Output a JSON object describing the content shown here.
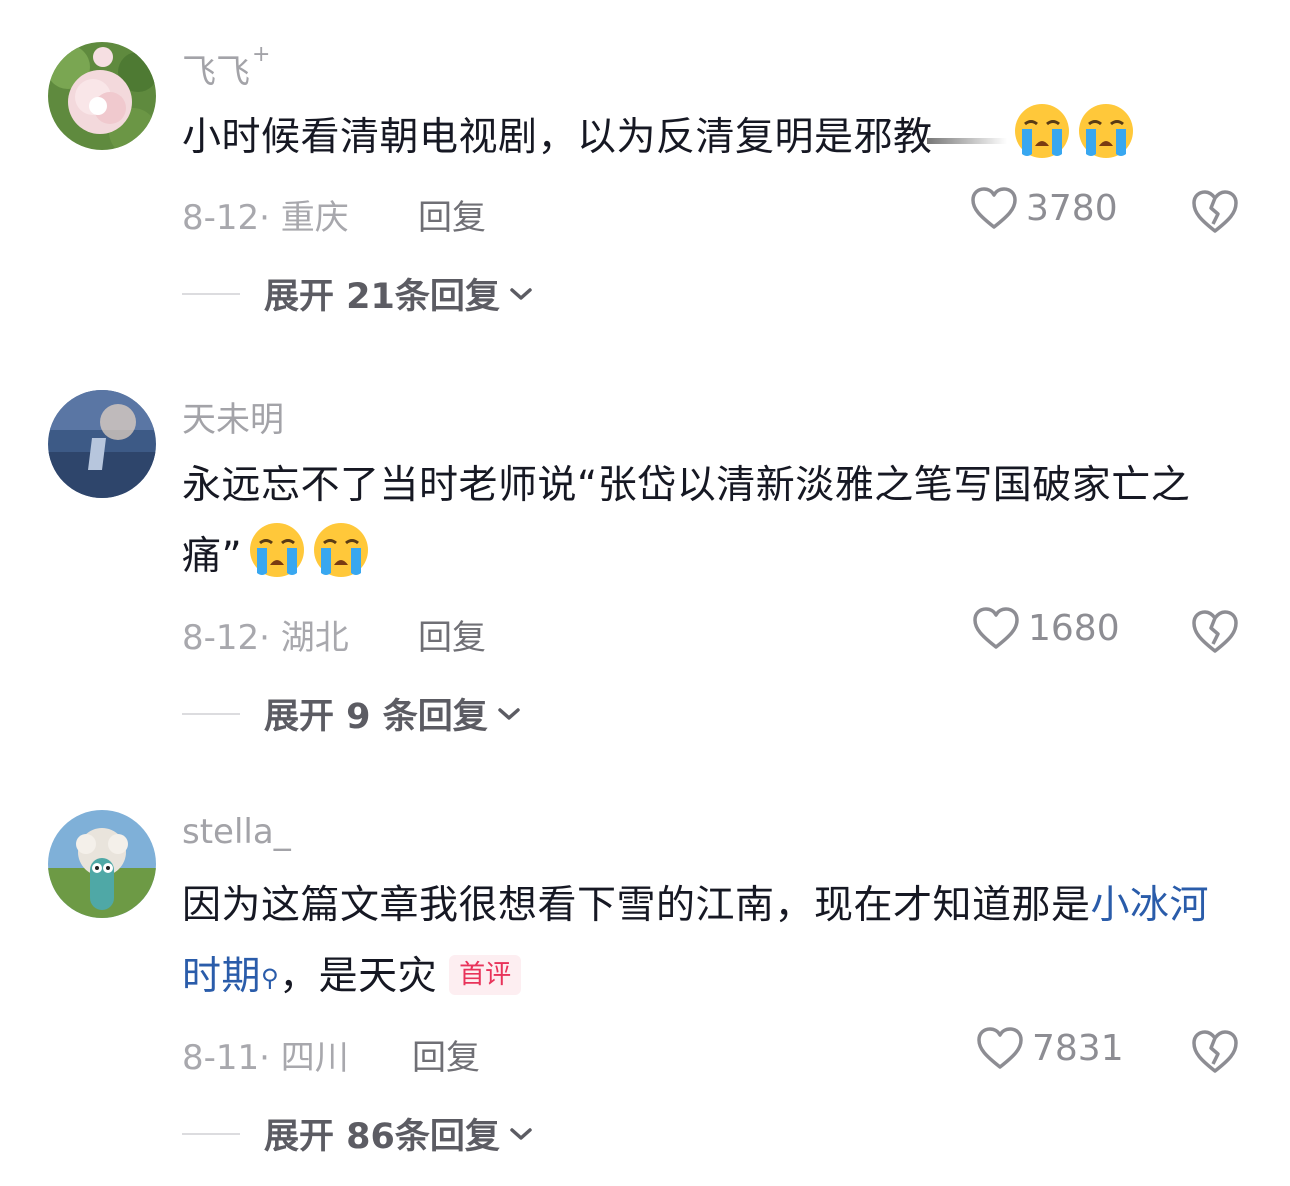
{
  "comments": [
    {
      "username": "飞飞",
      "badge_plus": "+",
      "text": "小时候看清朝电视剧，以为反清复明是邪教",
      "date": "8-12",
      "location": "重庆",
      "reply_label": "回复",
      "likes": "3780",
      "expand": "展开 21条回复"
    },
    {
      "username": "天未明",
      "text": "永远忘不了当时老师说“张岱以清新淡雅之笔写国破家亡之痛”",
      "date": "8-12",
      "location": "湖北",
      "reply_label": "回复",
      "likes": "1680",
      "expand": "展开 9 条回复"
    },
    {
      "username": "stella_",
      "text_before": "因为这篇文章我很想看下雪的江南，现在才知道那是",
      "link_text": "小冰河时期",
      "text_after": "，是天灾",
      "first_badge": "首评",
      "date": "8-11",
      "location": "四川",
      "reply_label": "回复",
      "likes": "7831",
      "expand": "展开 86条回复"
    }
  ],
  "colors": {
    "text": "#161823",
    "muted": "#a8a8ad",
    "link": "#2a5caa",
    "badge_text": "#e8335a",
    "badge_bg": "#fdeef1"
  },
  "icons": [
    "crying-emoji-icon",
    "heart-outline-icon",
    "broken-heart-icon",
    "chevron-down-icon",
    "search-icon"
  ]
}
